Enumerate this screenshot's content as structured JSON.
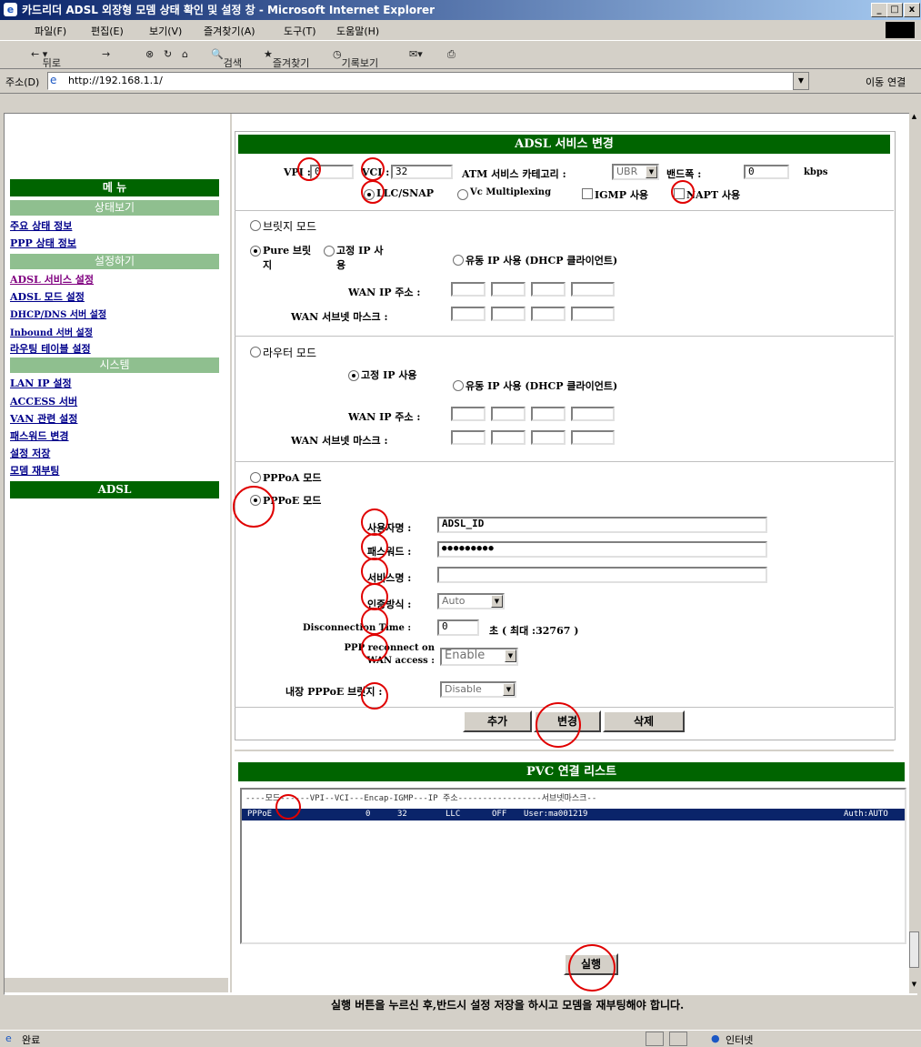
{
  "window": {
    "title": "카드리더 ADSL 외장형 모뎀 상태 확인 및 설정 창 - Microsoft Internet Explorer",
    "min": "_",
    "max": "□",
    "close": "x"
  },
  "menu": [
    "파일(F)",
    "편집(E)",
    "보기(V)",
    "즐겨찾기(A)",
    "도구(T)",
    "도움말(H)"
  ],
  "toolbar": {
    "back": "뒤로",
    "forward": "→",
    "search": "검색",
    "favorites": "즐겨찾기",
    "history": "기록보기"
  },
  "address": {
    "label": "주소(D)",
    "url": "http://192.168.1.1/",
    "go": "이동",
    "links": "연결"
  },
  "nav": {
    "menu_title": "메 뉴",
    "status_header": "상태보기",
    "status_items": [
      "주요 상태 정보",
      "PPP 상태 정보"
    ],
    "settings_header": "설정하기",
    "settings_items": [
      "ADSL 서비스 설정",
      "ADSL 모드 설정",
      "DHCP/DNS 서버 설정",
      "Inbound 서버 설정",
      "라우팅 테이블 설정"
    ],
    "system_header": "시스템",
    "system_items": [
      "LAN IP 설정",
      "ACCESS 서버",
      "VAN 관련 설정",
      "패스워드 변경",
      "설정 저장",
      "모뎀 재부팅"
    ],
    "footer": "ADSL"
  },
  "service": {
    "header": "ADSL 서비스 변경",
    "vpi_label": "VPI :",
    "vpi": "0",
    "vci_label": "VCI :",
    "vci": "32",
    "atm_label": "ATM 서비스 카테고리 :",
    "atm_value": "UBR",
    "bw_label": "밴드폭 :",
    "bw": "0",
    "bw_unit": "kbps",
    "llc": "LLC/SNAP",
    "vc": "Vc Multiplexing",
    "igmp": "IGMP 사용",
    "napt": "NAPT 사용"
  },
  "bridge": {
    "mode": "브릿지 모드",
    "pure": "Pure 브릿지",
    "static": "고정 IP 사용",
    "dhcp": "유동 IP 사용 (DHCP 클라이언트)",
    "wan_ip": "WAN IP 주소 :",
    "wan_mask": "WAN 서브넷 마스크 :"
  },
  "router": {
    "mode": "라우터 모드",
    "static": "고정 IP 사용",
    "dhcp": "유동 IP 사용 (DHCP 클라이언트)",
    "wan_ip": "WAN IP 주소 :",
    "wan_mask": "WAN 서브넷 마스크 :"
  },
  "ppp": {
    "pppoa": "PPPoA 모드",
    "pppoe": "PPPoE 모드",
    "user_label": "사용자명 :",
    "user": "ADSL_ID",
    "pass_label": "패스워드 :",
    "pass": "●●●●●●●●●",
    "svc_label": "서비스명 :",
    "svc": "",
    "auth_label": "인증방식 :",
    "auth": "Auto",
    "disc_label": "Disconnection Time :",
    "disc": "0",
    "disc_unit": "초 ( 최대 :32767 )",
    "recon_label": "PPP reconnect on WAN access :",
    "recon": "Enable",
    "bridge_label": "내장 PPPoE 브릿지 :",
    "bridge": "Disable"
  },
  "buttons": {
    "add": "추가",
    "modify": "변경",
    "delete": "삭제",
    "apply": "실행"
  },
  "pvc": {
    "header": "PVC 연결 리스트",
    "columns": "----모드------VPI--VCI---Encap-IGMP---IP 주소-----------------서브넷마스크--",
    "row": {
      "mode": "PPPoE",
      "vpi": "0",
      "vci": "32",
      "encap": "LLC",
      "igmp": "OFF",
      "ip": "User:ma001219",
      "mask": "Auth:AUTO"
    }
  },
  "notice": "실행 버튼을 누르신 후,반드시 설정 저장을 하시고 모뎀을 재부팅해야 합니다.",
  "status": {
    "done": "완료",
    "zone": "인터넷"
  }
}
